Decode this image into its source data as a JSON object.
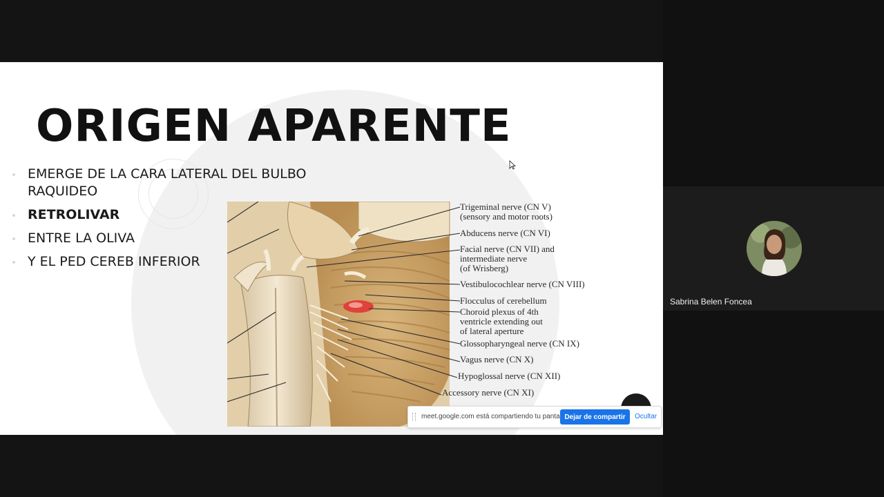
{
  "slide": {
    "title": "ORIGEN APARENTE",
    "bullets": [
      {
        "text": "EMERGE DE LA CARA LATERAL DEL BULBO RAQUIDEO",
        "bold": false
      },
      {
        "text": "RETROLIVAR",
        "bold": true
      },
      {
        "text": "ENTRE LA OLIVA",
        "bold": false
      },
      {
        "text": "Y EL PED CEREB INFERIOR",
        "bold": false
      }
    ],
    "figure_labels": {
      "trigeminal_1": "Trigeminal nerve (CN V)",
      "trigeminal_2": "(sensory and motor roots)",
      "abducens": "Abducens nerve (CN VI)",
      "facial_1": "Facial nerve (CN VII) and",
      "facial_2": "intermediate nerve",
      "facial_3": "(of Wrisberg)",
      "vestibulocochlear": "Vestibulocochlear nerve (CN VIII)",
      "flocculus": "Flocculus of cerebellum",
      "choroid_1": "Choroid plexus of 4th",
      "choroid_2": "ventricle extending out",
      "choroid_3": "of lateral aperture",
      "glossopharyngeal": "Glossopharyngeal nerve (CN IX)",
      "vagus": "Vagus nerve (CN X)",
      "hypoglossal": "Hypoglossal nerve (CN XII)",
      "accessory": "Accessory nerve (CN XI)"
    }
  },
  "share_bar": {
    "message": "meet.google.com está compartiendo tu pantalla.",
    "stop_label": "Dejar de compartir",
    "hide_label": "Ocultar"
  },
  "participant": {
    "name": "Sabrina Belen Foncea"
  },
  "colors": {
    "stop_button": "#1a73e8",
    "tile_background": "#1c1c1c",
    "page_background": "#111111"
  },
  "icons": [
    "cursor-icon",
    "drag-handle-icon",
    "avatar"
  ]
}
